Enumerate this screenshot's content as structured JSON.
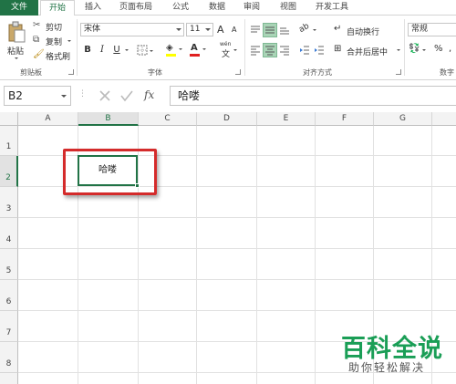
{
  "tabs": [
    "文件",
    "开始",
    "插入",
    "页面布局",
    "公式",
    "数据",
    "审阅",
    "视图",
    "开发工具"
  ],
  "ribbon": {
    "clipboard": {
      "paste": "粘贴",
      "cut": "剪切",
      "copy": "复制",
      "format_painter": "格式刷",
      "label": "剪贴板"
    },
    "font": {
      "name": "宋体",
      "size": "11",
      "label": "字体",
      "bold": "B",
      "italic": "I",
      "underline": "U",
      "grow": "A",
      "shrink": "A",
      "phonetic": "wén"
    },
    "alignment": {
      "wrap_text": "自动换行",
      "merge_center": "合并后居中",
      "label": "对齐方式"
    },
    "number": {
      "format": "常规",
      "percent": "%",
      "label": "数字"
    }
  },
  "formula_bar": {
    "name_box": "B2",
    "fx": "fx",
    "value": "哈喽"
  },
  "grid": {
    "columns": [
      "A",
      "B",
      "C",
      "D",
      "E",
      "F",
      "G"
    ],
    "rows": [
      "1",
      "2",
      "3",
      "4",
      "5",
      "6",
      "7",
      "8"
    ],
    "selected_column": "B",
    "selected_row": "2",
    "cell_b2": "哈喽"
  },
  "watermark": {
    "title": "百科全说",
    "subtitle": "助你轻松解决"
  },
  "colors": {
    "accent": "#217346",
    "highlight": "#d42b2b",
    "watermark": "#1a9e56"
  }
}
